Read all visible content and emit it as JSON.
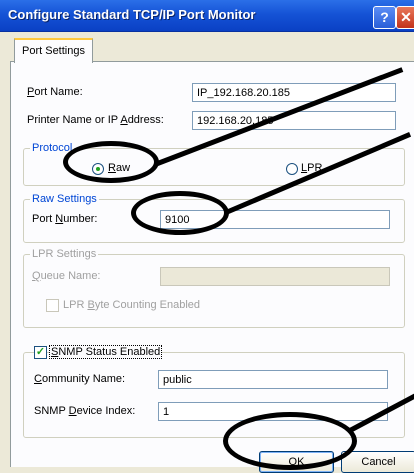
{
  "window": {
    "title": "Configure Standard TCP/IP Port Monitor"
  },
  "tabs": [
    {
      "label": "Port Settings"
    }
  ],
  "port_settings": {
    "port_name_label": "Port Name:",
    "port_name_value": "IP_192.168.20.185",
    "printer_name_label": "Printer Name or IP Address:",
    "printer_name_value": "192.168.20.185"
  },
  "protocol": {
    "title": "Protocol",
    "raw_label": "Raw",
    "lpr_label": "LPR",
    "selected": "Raw"
  },
  "raw_settings": {
    "title": "Raw Settings",
    "port_number_label": "Port Number:",
    "port_number_value": "9100"
  },
  "lpr_settings": {
    "title": "LPR Settings",
    "queue_name_label": "Queue Name:",
    "queue_name_value": "",
    "byte_counting_label": "LPR Byte Counting Enabled",
    "byte_counting_checked": false
  },
  "snmp": {
    "enabled_label": "SNMP Status Enabled",
    "enabled_checked": true,
    "community_label": "Community Name:",
    "community_value": "public",
    "device_index_label": "SNMP Device Index:",
    "device_index_value": "1"
  },
  "buttons": {
    "ok": "OK",
    "cancel": "Cancel"
  },
  "annotation_color": "#000000"
}
